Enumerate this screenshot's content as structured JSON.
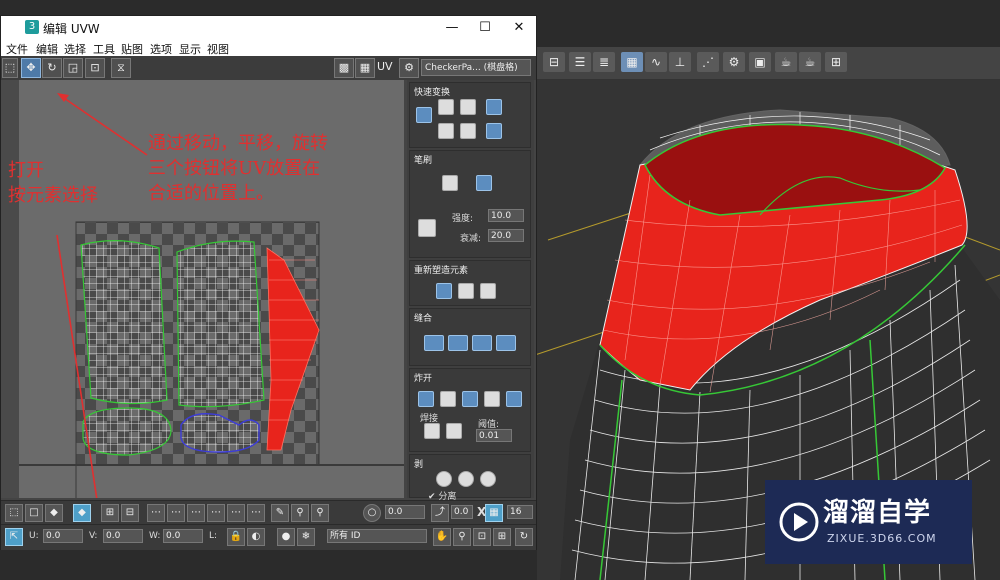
{
  "window": {
    "title": "编辑 UVW",
    "logo_glyph": "3",
    "controls": {
      "minimize": "—",
      "maximize": "☐",
      "close": "✕"
    }
  },
  "menu": [
    "文件",
    "编辑",
    "选择",
    "工具",
    "贴图",
    "选项",
    "显示",
    "视图"
  ],
  "toolbar": {
    "uv_label": "UV",
    "checker_select": "CheckerPa... (棋盘格)"
  },
  "right_panel": {
    "quick_transform": "快速变换",
    "brush": "笔刷",
    "strength_label": "强度:",
    "strength_value": "10.0",
    "falloff_label": "衰减:",
    "falloff_value": "20.0",
    "reshape": "重新塑造元素",
    "stitch": "缝合",
    "explode": "炸开",
    "weld_label": "焊接",
    "threshold_label": "阈值:",
    "threshold_value": "0.01",
    "peel": "剥",
    "detach_label": "分离"
  },
  "bottom_bar": {
    "rotate_value": "0.0",
    "xy_label": "XY",
    "grid_value": "16",
    "u_label": "U:",
    "u_value": "0.0",
    "v_label": "V:",
    "v_value": "0.0",
    "w_label": "W:",
    "w_value": "0.0",
    "l_label": "L:",
    "id_select": "所有 ID"
  },
  "annotations": {
    "move": [
      "通过移动，平移，旋转",
      "三个按钮将UV放置在",
      "合适的位置上。"
    ],
    "select": [
      "打开",
      "按元素选择"
    ]
  },
  "watermark": {
    "name": "溜溜自学",
    "url": "ZIXUE.3D66.COM"
  },
  "colors": {
    "selection_red": "#e8241c",
    "seam_green": "#36c836",
    "accent_blue": "#4e7aa8",
    "annotation_red": "#e03030"
  }
}
